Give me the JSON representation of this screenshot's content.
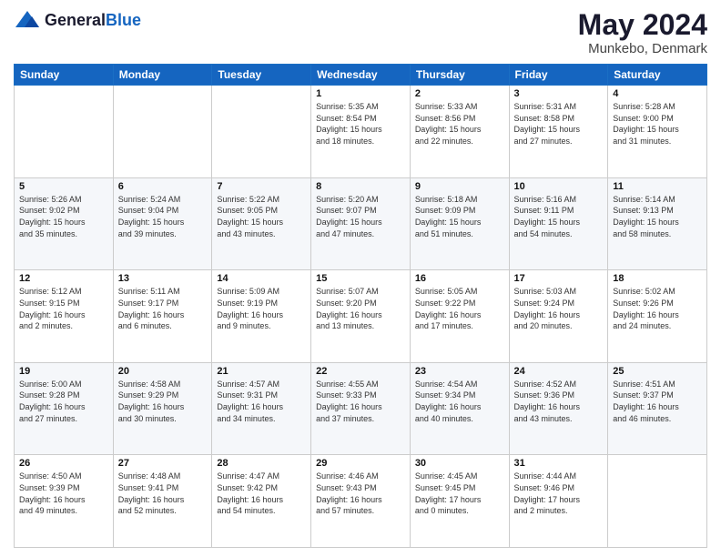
{
  "header": {
    "logo_general": "General",
    "logo_blue": "Blue",
    "month_title": "May 2024",
    "location": "Munkebo, Denmark"
  },
  "weekdays": [
    "Sunday",
    "Monday",
    "Tuesday",
    "Wednesday",
    "Thursday",
    "Friday",
    "Saturday"
  ],
  "weeks": [
    [
      {
        "day": "",
        "info": ""
      },
      {
        "day": "",
        "info": ""
      },
      {
        "day": "",
        "info": ""
      },
      {
        "day": "1",
        "info": "Sunrise: 5:35 AM\nSunset: 8:54 PM\nDaylight: 15 hours\nand 18 minutes."
      },
      {
        "day": "2",
        "info": "Sunrise: 5:33 AM\nSunset: 8:56 PM\nDaylight: 15 hours\nand 22 minutes."
      },
      {
        "day": "3",
        "info": "Sunrise: 5:31 AM\nSunset: 8:58 PM\nDaylight: 15 hours\nand 27 minutes."
      },
      {
        "day": "4",
        "info": "Sunrise: 5:28 AM\nSunset: 9:00 PM\nDaylight: 15 hours\nand 31 minutes."
      }
    ],
    [
      {
        "day": "5",
        "info": "Sunrise: 5:26 AM\nSunset: 9:02 PM\nDaylight: 15 hours\nand 35 minutes."
      },
      {
        "day": "6",
        "info": "Sunrise: 5:24 AM\nSunset: 9:04 PM\nDaylight: 15 hours\nand 39 minutes."
      },
      {
        "day": "7",
        "info": "Sunrise: 5:22 AM\nSunset: 9:05 PM\nDaylight: 15 hours\nand 43 minutes."
      },
      {
        "day": "8",
        "info": "Sunrise: 5:20 AM\nSunset: 9:07 PM\nDaylight: 15 hours\nand 47 minutes."
      },
      {
        "day": "9",
        "info": "Sunrise: 5:18 AM\nSunset: 9:09 PM\nDaylight: 15 hours\nand 51 minutes."
      },
      {
        "day": "10",
        "info": "Sunrise: 5:16 AM\nSunset: 9:11 PM\nDaylight: 15 hours\nand 54 minutes."
      },
      {
        "day": "11",
        "info": "Sunrise: 5:14 AM\nSunset: 9:13 PM\nDaylight: 15 hours\nand 58 minutes."
      }
    ],
    [
      {
        "day": "12",
        "info": "Sunrise: 5:12 AM\nSunset: 9:15 PM\nDaylight: 16 hours\nand 2 minutes."
      },
      {
        "day": "13",
        "info": "Sunrise: 5:11 AM\nSunset: 9:17 PM\nDaylight: 16 hours\nand 6 minutes."
      },
      {
        "day": "14",
        "info": "Sunrise: 5:09 AM\nSunset: 9:19 PM\nDaylight: 16 hours\nand 9 minutes."
      },
      {
        "day": "15",
        "info": "Sunrise: 5:07 AM\nSunset: 9:20 PM\nDaylight: 16 hours\nand 13 minutes."
      },
      {
        "day": "16",
        "info": "Sunrise: 5:05 AM\nSunset: 9:22 PM\nDaylight: 16 hours\nand 17 minutes."
      },
      {
        "day": "17",
        "info": "Sunrise: 5:03 AM\nSunset: 9:24 PM\nDaylight: 16 hours\nand 20 minutes."
      },
      {
        "day": "18",
        "info": "Sunrise: 5:02 AM\nSunset: 9:26 PM\nDaylight: 16 hours\nand 24 minutes."
      }
    ],
    [
      {
        "day": "19",
        "info": "Sunrise: 5:00 AM\nSunset: 9:28 PM\nDaylight: 16 hours\nand 27 minutes."
      },
      {
        "day": "20",
        "info": "Sunrise: 4:58 AM\nSunset: 9:29 PM\nDaylight: 16 hours\nand 30 minutes."
      },
      {
        "day": "21",
        "info": "Sunrise: 4:57 AM\nSunset: 9:31 PM\nDaylight: 16 hours\nand 34 minutes."
      },
      {
        "day": "22",
        "info": "Sunrise: 4:55 AM\nSunset: 9:33 PM\nDaylight: 16 hours\nand 37 minutes."
      },
      {
        "day": "23",
        "info": "Sunrise: 4:54 AM\nSunset: 9:34 PM\nDaylight: 16 hours\nand 40 minutes."
      },
      {
        "day": "24",
        "info": "Sunrise: 4:52 AM\nSunset: 9:36 PM\nDaylight: 16 hours\nand 43 minutes."
      },
      {
        "day": "25",
        "info": "Sunrise: 4:51 AM\nSunset: 9:37 PM\nDaylight: 16 hours\nand 46 minutes."
      }
    ],
    [
      {
        "day": "26",
        "info": "Sunrise: 4:50 AM\nSunset: 9:39 PM\nDaylight: 16 hours\nand 49 minutes."
      },
      {
        "day": "27",
        "info": "Sunrise: 4:48 AM\nSunset: 9:41 PM\nDaylight: 16 hours\nand 52 minutes."
      },
      {
        "day": "28",
        "info": "Sunrise: 4:47 AM\nSunset: 9:42 PM\nDaylight: 16 hours\nand 54 minutes."
      },
      {
        "day": "29",
        "info": "Sunrise: 4:46 AM\nSunset: 9:43 PM\nDaylight: 16 hours\nand 57 minutes."
      },
      {
        "day": "30",
        "info": "Sunrise: 4:45 AM\nSunset: 9:45 PM\nDaylight: 17 hours\nand 0 minutes."
      },
      {
        "day": "31",
        "info": "Sunrise: 4:44 AM\nSunset: 9:46 PM\nDaylight: 17 hours\nand 2 minutes."
      },
      {
        "day": "",
        "info": ""
      }
    ]
  ]
}
